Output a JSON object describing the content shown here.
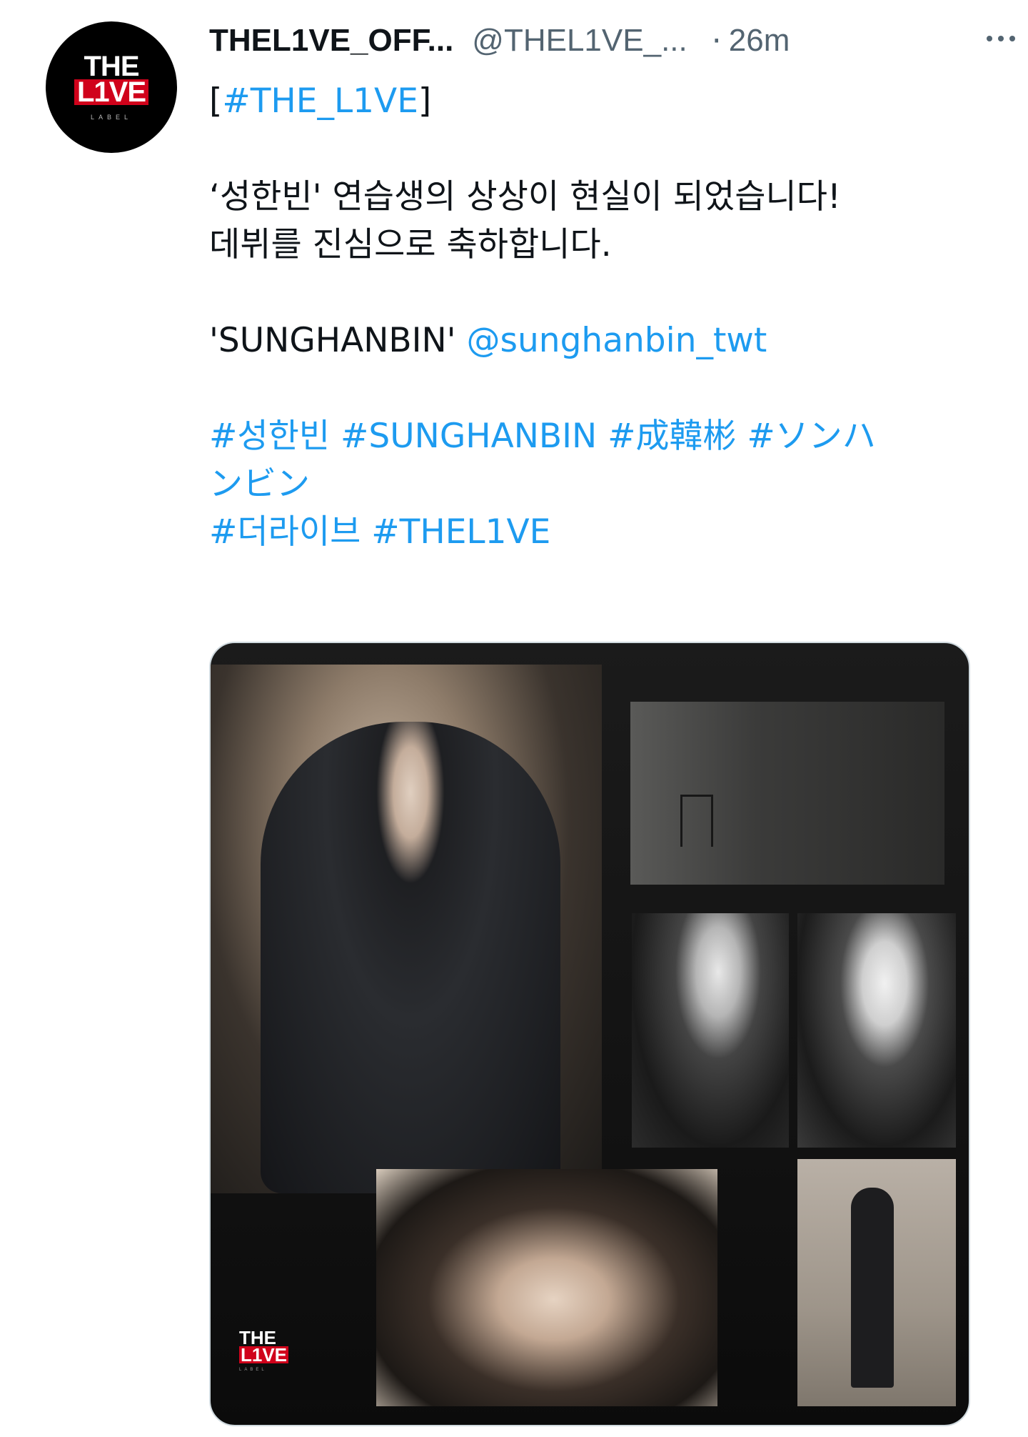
{
  "account": {
    "display_name": "THEL1VE_OFF...",
    "handle": "@THEL1VE_...",
    "separator": "·",
    "timestamp": "26m",
    "avatar_logo": {
      "top": "THE",
      "middle": "L1VE",
      "sub": "LABEL"
    }
  },
  "tweet": {
    "tag_open": "[",
    "tag": "#THE_L1VE",
    "tag_close": "]",
    "line1": "‘성한빈' 연습생의 상상이 현실이 되었습니다!",
    "line2": "데뷔를 진심으로 축하합니다.",
    "name_quote": "'SUNGHANBIN'",
    "mention": "@sunghanbin_twt",
    "hashtags_line1": "#성한빈 #SUNGHANBIN #成韓彬 #ソンハ",
    "hashtags_line2": "ンビン",
    "hashtags_line3": "#더라이브 #THEL1VE"
  },
  "media": {
    "watermark": {
      "top": "THE",
      "middle": "L1VE",
      "sub": "LABEL"
    }
  },
  "icons": {
    "more": "more-horizontal-icon"
  },
  "colors": {
    "link": "#1d9bf0",
    "secondary_text": "#536471",
    "brand_red": "#d0021b"
  }
}
